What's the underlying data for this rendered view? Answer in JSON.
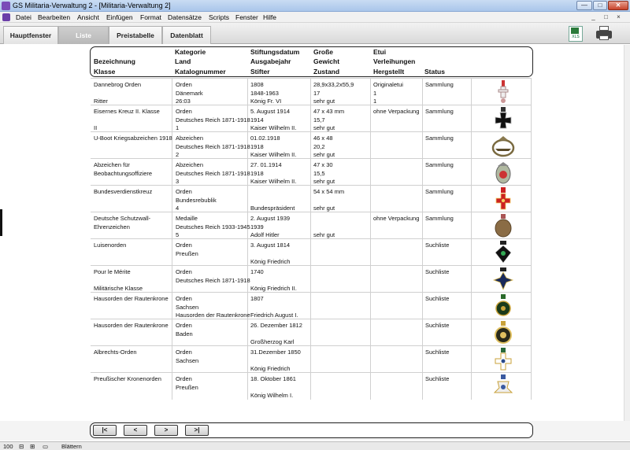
{
  "window": {
    "title": "GS Militaria-Verwaltung 2 - [Militaria-Verwaltung 2]",
    "btn_min": "—",
    "btn_max": "□",
    "btn_close": "✕"
  },
  "menu": [
    "Datei",
    "Bearbeiten",
    "Ansicht",
    "Einfügen",
    "Format",
    "Datensätze",
    "Scripts",
    "Fenster",
    "Hilfe"
  ],
  "mdi_controls": [
    "_",
    "□",
    "×"
  ],
  "tabs": [
    "Hauptfenster",
    "Liste",
    "Preistabelle",
    "Datenblatt"
  ],
  "toolbar": {
    "xls_label": "XLS"
  },
  "headers": {
    "bezeichnung": "Bezeichnung",
    "klasse": "Klasse",
    "kategorie": "Kategorie",
    "land": "Land",
    "katalognummer": "Katalognummer",
    "stiftungsdatum": "Stiftungsdatum",
    "ausgabejahr": "Ausgabejahr",
    "stifter": "Stifter",
    "groesse": "Große",
    "gewicht": "Gewicht",
    "zustand": "Zustand",
    "etui": "Etui",
    "verleihungen": "Verleihungen",
    "hergestellt": "Hergstellt",
    "status": "Status"
  },
  "rows": [
    {
      "name": [
        "Dannebrog Orden",
        "",
        "Ritter"
      ],
      "cat": [
        "Orden",
        "Dänemark",
        "26:03"
      ],
      "date": [
        "1808",
        "1848-1963",
        "König Fr. VI"
      ],
      "size": [
        "28,9x33,2x55,9",
        "17",
        "sehr gut"
      ],
      "etui": [
        "Originaletui",
        "1",
        "1"
      ],
      "status": "Sammlung",
      "medal": "dannebrog"
    },
    {
      "name": [
        "Eisernes Kreuz II. Klasse",
        "",
        "II"
      ],
      "cat": [
        "Orden",
        "Deutsches Reich 1871-1918",
        "1"
      ],
      "date": [
        " 5. August 1914",
        "1914",
        "Kaiser Wilhelm II."
      ],
      "size": [
        "47 x 43 mm",
        "15,7",
        "sehr gut"
      ],
      "etui": [
        "ohne Verpackung",
        "",
        ""
      ],
      "status": "Sammlung",
      "medal": "iron-cross"
    },
    {
      "name": [
        "U-Boot Kriegsabzeichen 1918",
        "",
        ""
      ],
      "cat": [
        "Abzeichen",
        "Deutsches Reich 1871-1918",
        "2"
      ],
      "date": [
        "01.02.1918",
        "1918",
        "Kaiser Wilhelm II."
      ],
      "size": [
        "46 x 48",
        "20,2",
        "sehr gut"
      ],
      "etui": [
        "",
        "",
        ""
      ],
      "status": "Sammlung",
      "medal": "uboot"
    },
    {
      "name": [
        "Abzeichen für",
        "Beobachtungsoffiziere",
        ""
      ],
      "cat": [
        "Abzeichen",
        "Deutsches Reich 1871-1918",
        "3"
      ],
      "date": [
        "27. 01.1914",
        "1918",
        "Kaiser Wilhelm II."
      ],
      "size": [
        "47 x 30",
        "15,5",
        "sehr gut"
      ],
      "etui": [
        "",
        "",
        ""
      ],
      "status": "Sammlung",
      "medal": "observer"
    },
    {
      "name": [
        "Bundesverdienstkreuz",
        "",
        ""
      ],
      "cat": [
        "Orden",
        "Bundesrebublik",
        "4"
      ],
      "date": [
        "",
        "",
        "Bundespräsident"
      ],
      "size": [
        "54 x 54 mm",
        "",
        "sehr gut"
      ],
      "etui": [
        "",
        "",
        ""
      ],
      "status": "Sammlung",
      "medal": "bvk"
    },
    {
      "name": [
        "Deutsche Schutzwall-",
        "Ehrenzeichen",
        ""
      ],
      "cat": [
        "Medaille",
        "Deutsches Reich 1933-1945",
        "5"
      ],
      "date": [
        " 2. August 1939",
        "1939",
        "Adolf Hitler"
      ],
      "size": [
        "",
        "",
        "sehr gut"
      ],
      "etui": [
        "ohne Verpackung",
        "",
        ""
      ],
      "status": "Sammlung",
      "medal": "schutzwall"
    },
    {
      "name": [
        "Luisenorden",
        "",
        ""
      ],
      "cat": [
        "Orden",
        "Preußen",
        ""
      ],
      "date": [
        "3. August 1814",
        "",
        "König Friedrich"
      ],
      "size": [
        "",
        "",
        ""
      ],
      "etui": [
        "",
        "",
        ""
      ],
      "status": "Suchliste",
      "medal": "luise"
    },
    {
      "name": [
        "Pour le Mérite",
        "",
        "Militärische Klasse"
      ],
      "cat": [
        "Orden",
        "Deutsches Reich 1871-1918",
        ""
      ],
      "date": [
        "1740",
        "",
        "König Friedrich II."
      ],
      "size": [
        "",
        "",
        ""
      ],
      "etui": [
        "",
        "",
        ""
      ],
      "status": "Suchliste",
      "medal": "pourlemerite"
    },
    {
      "name": [
        "Hausorden der Rautenkrone",
        "",
        ""
      ],
      "cat": [
        "Orden",
        "Sachsen",
        "Hausorden der Rautenkrone"
      ],
      "date": [
        "1807",
        "",
        "Friedrich August I."
      ],
      "size": [
        "",
        "",
        ""
      ],
      "etui": [
        "",
        "",
        ""
      ],
      "status": "Suchliste",
      "medal": "rautenkrone1"
    },
    {
      "name": [
        "Hausorden der Rautenkrone",
        "",
        ""
      ],
      "cat": [
        "Orden",
        "Baden",
        ""
      ],
      "date": [
        "26. Dezember 1812",
        "",
        "Großherzog Karl"
      ],
      "size": [
        "",
        "",
        ""
      ],
      "etui": [
        "",
        "",
        ""
      ],
      "status": "Suchliste",
      "medal": "rautenkrone2"
    },
    {
      "name": [
        "Albrechts-Orden",
        "",
        ""
      ],
      "cat": [
        "Orden",
        "Sachsen",
        ""
      ],
      "date": [
        "31.Dezember 1850",
        "",
        "König Friedrich"
      ],
      "size": [
        "",
        "",
        ""
      ],
      "etui": [
        "",
        "",
        ""
      ],
      "status": "Suchliste",
      "medal": "albrecht"
    },
    {
      "name": [
        "Preußischer Kronenorden",
        "",
        ""
      ],
      "cat": [
        "Orden",
        "Preußen",
        ""
      ],
      "date": [
        "18. Oktober 1861",
        "",
        "König Wilhelm I."
      ],
      "size": [
        "",
        "",
        ""
      ],
      "etui": [
        "",
        "",
        ""
      ],
      "status": "Suchliste",
      "medal": "kronen"
    }
  ],
  "nav": [
    "|<",
    "<",
    ">",
    ">|"
  ],
  "status": {
    "zoom": "100",
    "mode": "Blättern"
  }
}
